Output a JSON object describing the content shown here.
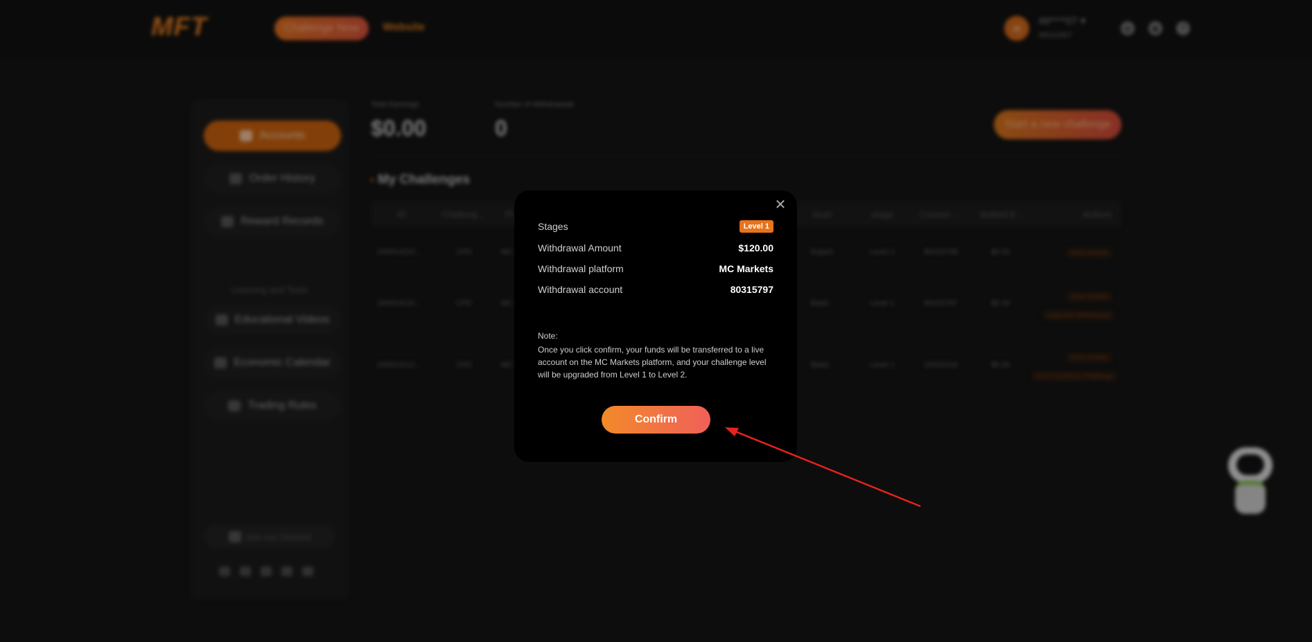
{
  "header": {
    "logo": "MFT",
    "challenge_button": "Challenge Now",
    "website_link": "Website",
    "avatar_initials": "Al",
    "user_name": "46****07 ▾",
    "user_id": "46010307",
    "icons": [
      "globe-icon",
      "discord-icon",
      "help-icon"
    ]
  },
  "sidebar": {
    "items": [
      {
        "label": "Accounts",
        "active": true
      },
      {
        "label": "Order History"
      },
      {
        "label": "Reward Records"
      }
    ],
    "section_title": "Learning and Tools",
    "tools": [
      {
        "label": "Educational Videos"
      },
      {
        "label": "Economic Calendar"
      },
      {
        "label": "Trading Rules"
      }
    ],
    "discord": "Join our Discord"
  },
  "stats": {
    "earnings_label": "Total Earnings",
    "earnings_value": "$0.00",
    "withdrawals_label": "Number of Withdrawals",
    "withdrawals_value": "0",
    "new_challenge": "Start a new challenge"
  },
  "challenges": {
    "title": "My Challenges",
    "columns": [
      "ID",
      "Challeng...",
      "Pl",
      "level",
      "stage",
      "Current ...",
      "Settled E...",
      "Actions"
    ],
    "rows": [
      {
        "id": "240914115...",
        "type": "CFD",
        "platform": "MC",
        "level": "Expert",
        "stage": "Level 1",
        "current": "80315798",
        "settled": "$0.00",
        "actions": [
          "View Details"
        ]
      },
      {
        "id": "240914115...",
        "type": "CFD",
        "platform": "MC",
        "level": "Basic",
        "stage": "Level 1",
        "current": "80315797",
        "settled": "$0.00",
        "actions": [
          "View Details",
          "Upgrade Withdrawal"
        ]
      },
      {
        "id": "240914112...",
        "type": "CFD",
        "platform": "MC",
        "level": "Basic",
        "stage": "Level 1",
        "current": "10010216",
        "settled": "$0.00",
        "actions": [
          "View Details",
          "ns to Continue Challenge"
        ]
      }
    ]
  },
  "modal": {
    "stages_label": "Stages",
    "stages_value": "Level 1",
    "amount_label": "Withdrawal Amount",
    "amount_value": "$120.00",
    "platform_label": "Withdrawal platform",
    "platform_value": "MC Markets",
    "account_label": "Withdrawal account",
    "account_value": "80315797",
    "note_label": "Note:",
    "note_text": "Once you click confirm, your funds will be transferred to a live account on the MC Markets platform, and your challenge level will be upgraded from Level 1 to Level 2.",
    "confirm": "Confirm",
    "accent": "#e8731a"
  },
  "annotation": {
    "arrow_color": "#e8231f"
  }
}
